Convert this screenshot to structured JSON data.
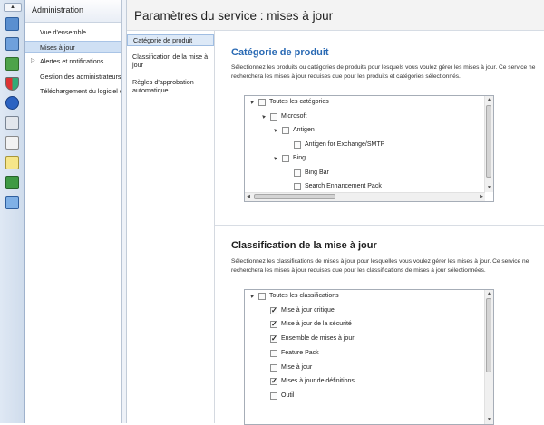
{
  "rail": {
    "icons": [
      "scroll-up-icon",
      "server-icon",
      "computers-icon",
      "updates-icon",
      "security-icon",
      "info-icon",
      "reports-icon",
      "deploy-icon",
      "notes-icon",
      "database-icon",
      "settings-icon"
    ]
  },
  "nav": {
    "header": "Administration",
    "items": [
      {
        "label": "Vue d'ensemble",
        "selected": false,
        "expandable": false
      },
      {
        "label": "Mises à jour",
        "selected": true,
        "expandable": false
      },
      {
        "label": "Alertes et notifications",
        "selected": false,
        "expandable": true
      },
      {
        "label": "Gestion des administrateurs",
        "selected": false,
        "expandable": false
      },
      {
        "label": "Téléchargement du logiciel c",
        "selected": false,
        "expandable": false
      }
    ]
  },
  "page": {
    "title": "Paramètres du service : mises à jour"
  },
  "subnav": [
    {
      "label": "Catégorie de produit",
      "selected": true
    },
    {
      "label": "Classification de la mise à jour",
      "selected": false
    },
    {
      "label": "Règles d'approbation automatique",
      "selected": false
    }
  ],
  "products": {
    "title": "Catégorie de produit",
    "description": "Sélectionnez les produits ou catégories de produits pour lesquels vous voulez gérer les mises à jour. Ce service ne recherchera les mises à jour requises que pour les produits et catégories sélectionnés.",
    "tree": [
      {
        "label": "Toutes les catégories",
        "level": 0,
        "expander": "▲",
        "checked": false
      },
      {
        "label": "Microsoft",
        "level": 1,
        "expander": "▲",
        "checked": false
      },
      {
        "label": "Antigen",
        "level": 2,
        "expander": "▲",
        "checked": false
      },
      {
        "label": "Antigen for Exchange/SMTP",
        "level": 3,
        "expander": "",
        "checked": false
      },
      {
        "label": "Bing",
        "level": 2,
        "expander": "▲",
        "checked": false
      },
      {
        "label": "Bing Bar",
        "level": 3,
        "expander": "",
        "checked": false
      },
      {
        "label": "Search Enhancement Pack",
        "level": 3,
        "expander": "",
        "checked": false
      }
    ]
  },
  "classifications": {
    "title": "Classification de la mise à jour",
    "description": "Sélectionnez les classifications de mises à jour pour lesquelles vous voulez gérer les mises à jour. Ce service ne recherchera les mises à jour requises que pour les classifications de mises à jour sélectionnées.",
    "tree": [
      {
        "label": "Toutes les classifications",
        "level": 0,
        "expander": "▲",
        "checked": false
      },
      {
        "label": "Mise à jour critique",
        "level": 1,
        "expander": "",
        "checked": true
      },
      {
        "label": "Mise à jour de la sécurité",
        "level": 1,
        "expander": "",
        "checked": true
      },
      {
        "label": "Ensemble de mises à jour",
        "level": 1,
        "expander": "",
        "checked": true
      },
      {
        "label": "Feature Pack",
        "level": 1,
        "expander": "",
        "checked": false
      },
      {
        "label": "Mise à jour",
        "level": 1,
        "expander": "",
        "checked": false
      },
      {
        "label": "Mises à jour de définitions",
        "level": 1,
        "expander": "",
        "checked": true
      },
      {
        "label": "Outil",
        "level": 1,
        "expander": "",
        "checked": false
      }
    ]
  },
  "glyphs": {
    "check": "✓",
    "up": "▲",
    "down": "▼",
    "left": "◀",
    "right": "▶",
    "expand": "▷"
  }
}
